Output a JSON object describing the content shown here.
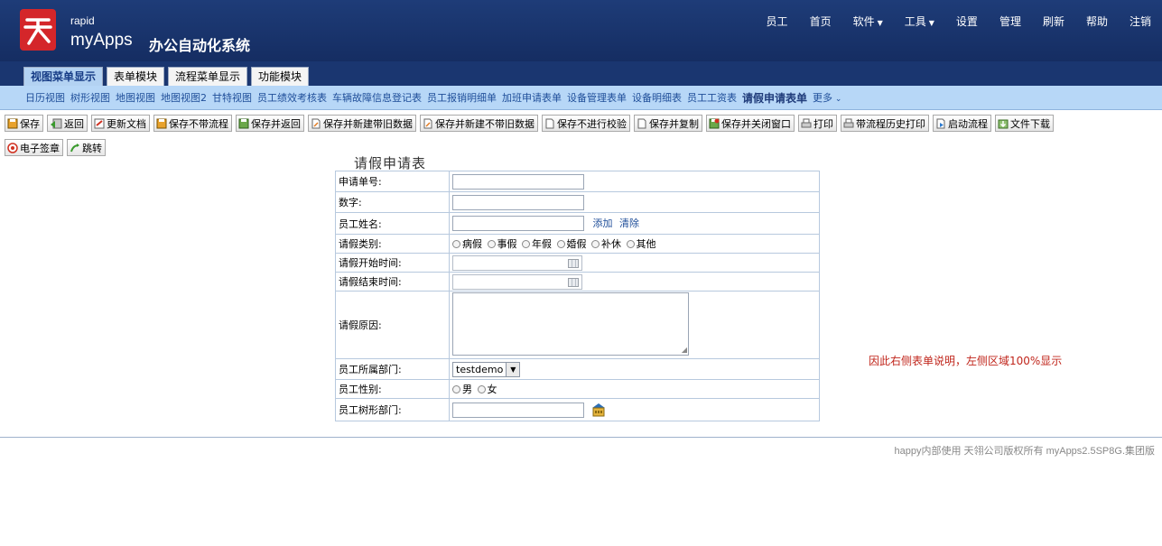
{
  "header": {
    "brand_small": "rapid",
    "brand_name": "myApps",
    "system_name": "办公自动化系统",
    "nav": [
      {
        "label": "员工"
      },
      {
        "label": "首页"
      },
      {
        "label": "软件",
        "dropdown": true
      },
      {
        "label": "工具",
        "dropdown": true
      },
      {
        "label": "设置"
      },
      {
        "label": "管理"
      },
      {
        "label": "刷新"
      },
      {
        "label": "帮助"
      },
      {
        "label": "注销"
      }
    ]
  },
  "tabs": [
    "视图菜单显示",
    "表单模块",
    "流程菜单显示",
    "功能模块"
  ],
  "views": [
    "日历视图",
    "树形视图",
    "地图视图",
    "地图视图2",
    "甘特视图",
    "员工绩效考核表",
    "车辆故障信息登记表",
    "员工报销明细单",
    "加班申请表单",
    "设备管理表单",
    "设备明细表",
    "员工工资表",
    "请假申请表单",
    "更多"
  ],
  "toolbar": [
    "保存",
    "返回",
    "更新文档",
    "保存不带流程",
    "保存并返回",
    "保存并新建带旧数据",
    "保存并新建不带旧数据",
    "保存不进行校验",
    "保存并复制",
    "保存并关闭窗口",
    "打印",
    "带流程历史打印",
    "启动流程",
    "文件下载"
  ],
  "toolbar2": [
    "电子签章",
    "跳转"
  ],
  "form": {
    "title": "请假申请表",
    "labels": {
      "apply_no": "申请单号:",
      "number": "数字:",
      "emp_name": "员工姓名:",
      "leave_type": "请假类别:",
      "start_time": "请假开始时间:",
      "end_time": "请假结束时间:",
      "reason": "请假原因:",
      "dept": "员工所属部门:",
      "gender": "员工性别:",
      "tree_dept": "员工树形部门:"
    },
    "add_link": "添加",
    "clear_link": "清除",
    "leave_types": [
      "病假",
      "事假",
      "年假",
      "婚假",
      "补休",
      "其他"
    ],
    "dept_value": "testdemo",
    "genders": [
      "男",
      "女"
    ]
  },
  "note": "因此右侧表单说明，左侧区域100%显示",
  "footer": "happy内部使用 天翎公司版权所有 myApps2.5SP8G.集团版",
  "colors": {
    "header_bg": "#1e3c78",
    "viewbar_bg": "#b7d7f7",
    "note": "#c0251b"
  }
}
